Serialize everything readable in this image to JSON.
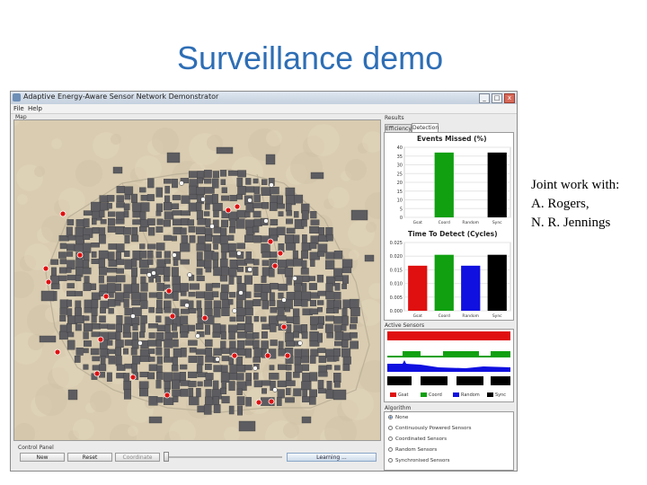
{
  "slide": {
    "title": "Surveillance demo",
    "credits": [
      "Joint work with:",
      "A. Rogers,",
      "N. R. Jennings"
    ]
  },
  "window": {
    "title": "Adaptive Energy-Aware Sensor Network Demonstrator",
    "menu": [
      "File",
      "Help"
    ],
    "buttons": {
      "minimize": "_",
      "maximize": "□",
      "close": "x"
    }
  },
  "map_panel": {
    "label": "Map"
  },
  "control_panel": {
    "label": "Control Panel",
    "new_label": "New",
    "reset_label": "Reset",
    "coordinate_label": "Coordinate",
    "right_button_label": "Learning ...",
    "slider_value": 0.0
  },
  "results_panel": {
    "label": "Results",
    "tabs": [
      "Efficiency",
      "Detection"
    ],
    "active_tab": "Detection"
  },
  "chart_data": [
    {
      "type": "bar",
      "title": "Events Missed (%)",
      "categories": [
        "Gsat",
        "Coord",
        "Random",
        "Sync"
      ],
      "values": [
        0,
        37,
        0,
        37
      ],
      "colors": [
        "#e01010",
        "#10a010",
        "#1010e0",
        "#000000"
      ],
      "yticks": [
        "40",
        "35",
        "30",
        "25",
        "20",
        "15",
        "10",
        "5",
        "0"
      ],
      "ylim": [
        0,
        40
      ]
    },
    {
      "type": "bar",
      "title": "Time To Detect (Cycles)",
      "categories": [
        "Gsat",
        "Coord",
        "Random",
        "Sync"
      ],
      "values": [
        0.0165,
        0.0205,
        0.0165,
        0.0205
      ],
      "colors": [
        "#e01010",
        "#10a010",
        "#1010e0",
        "#000000"
      ],
      "yticks": [
        "0.025",
        "0.020",
        "0.015",
        "0.010",
        "0.005",
        "0.000"
      ],
      "ylim": [
        0,
        0.025
      ]
    }
  ],
  "active_sensors": {
    "label": "Active Sensors",
    "legend": [
      "Gsat",
      "Coord",
      "Random",
      "Sync"
    ],
    "colors": [
      "#e01010",
      "#10a010",
      "#1010e0",
      "#000000"
    ]
  },
  "algorithm": {
    "label": "Algorithm",
    "options": [
      "None",
      "Continuously Powered Sensors",
      "Coordinated Sensors",
      "Random Sensors",
      "Synchronised Sensors"
    ],
    "selected": "None"
  },
  "colors": {
    "title_blue": "#2e6eb5",
    "map_background": "#d9ccb0",
    "building_fill": "#5d5d61",
    "sensor_active": "#e01010",
    "sensor_idle": "#ffffff"
  }
}
